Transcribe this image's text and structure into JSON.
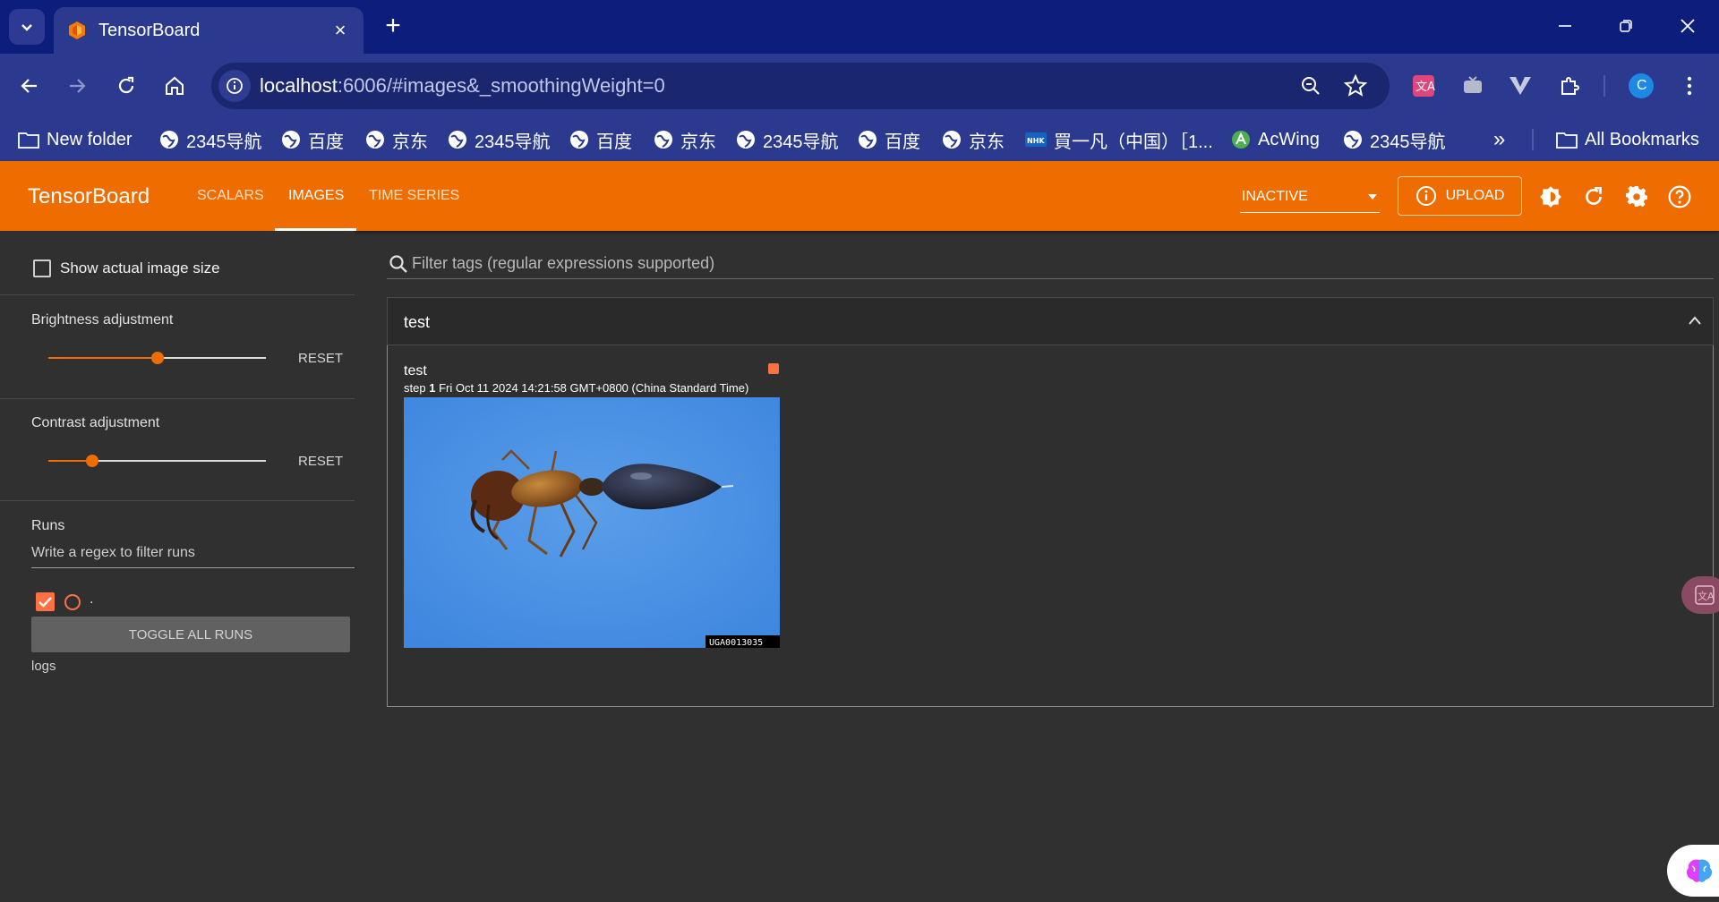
{
  "browser": {
    "tab_title": "TensorBoard",
    "url_host": "localhost",
    "url_rest": ":6006/#images&_smoothingWeight=0",
    "profile_letter": "C",
    "bookmarks": [
      "New folder",
      "2345导航",
      "百度",
      "京东",
      "2345导航",
      "百度",
      "京东",
      "2345导航",
      "百度",
      "京东",
      "買一凡（中国）［1...",
      "AcWing",
      "2345导航"
    ],
    "overflow_label": "»",
    "all_bookmarks": "All Bookmarks"
  },
  "tb": {
    "logo": "TensorBoard",
    "tabs": [
      "SCALARS",
      "IMAGES",
      "TIME SERIES"
    ],
    "active_tab": "IMAGES",
    "inactive_label": "INACTIVE",
    "upload_label": "UPLOAD",
    "colors": {
      "header": "#ef6c00",
      "background": "#303030",
      "run_swatch": "#ff7043"
    }
  },
  "sidebar": {
    "show_actual_size": "Show actual image size",
    "brightness_label": "Brightness adjustment",
    "brightness_value": 0.5,
    "contrast_label": "Contrast adjustment",
    "contrast_value": 0.2,
    "reset_label": "RESET",
    "runs_label": "Runs",
    "regex_placeholder": "Write a regex to filter runs",
    "run_name": ".",
    "toggle_all": "TOGGLE ALL RUNS",
    "logs_label": "logs"
  },
  "main": {
    "filter_placeholder": "Filter tags (regular expressions supported)",
    "group_title": "test",
    "card": {
      "title": "test",
      "step_label": "step",
      "step_value": "1",
      "timestamp": "Fri Oct 11 2024 14:21:58 GMT+0800 (China Standard Time)",
      "image_watermark": "UGA0013035"
    }
  }
}
